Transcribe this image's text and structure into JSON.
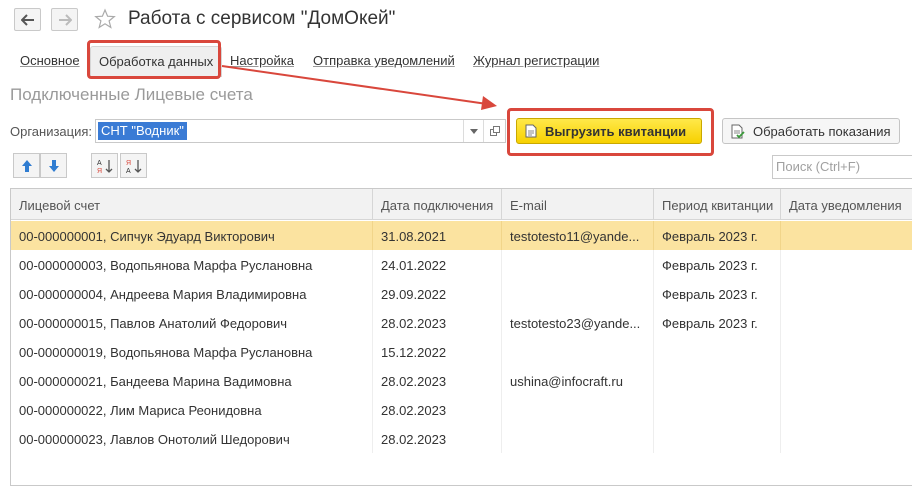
{
  "window": {
    "title": "Работа с сервисом \"ДомОкей\""
  },
  "tabs": [
    {
      "label": "Основное"
    },
    {
      "label": "Обработка данных"
    },
    {
      "label": "Настройка"
    },
    {
      "label": "Отправка уведомлений"
    },
    {
      "label": "Журнал регистрации"
    }
  ],
  "section_title": "Подключенные Лицевые счета",
  "organization": {
    "label": "Организация:",
    "value": "СНТ \"Водник\""
  },
  "buttons": {
    "export_receipts": "Выгрузить квитанции",
    "process_readings": "Обработать показания"
  },
  "search": {
    "placeholder": "Поиск (Ctrl+F)"
  },
  "table": {
    "columns": [
      "Лицевой счет",
      "Дата подключения",
      "E-mail",
      "Период квитанции",
      "Дата уведомления"
    ],
    "rows": [
      {
        "account": "00-000000001, Сипчук Эдуард Викторович",
        "date": "31.08.2021",
        "email": "testotesto11@yande...",
        "period": "Февраль 2023 г.",
        "notify": ""
      },
      {
        "account": "00-000000003, Водопьянова Марфа Руслановна",
        "date": "24.01.2022",
        "email": "",
        "period": "Февраль 2023 г.",
        "notify": ""
      },
      {
        "account": "00-000000004, Андреева Мария Владимировна",
        "date": "29.09.2022",
        "email": "",
        "period": "Февраль 2023 г.",
        "notify": ""
      },
      {
        "account": "00-000000015, Павлов Анатолий Федорович",
        "date": "28.02.2023",
        "email": "testotesto23@yande...",
        "period": "Февраль 2023 г.",
        "notify": ""
      },
      {
        "account": "00-000000019, Водопьянова Марфа Руслановна",
        "date": "15.12.2022",
        "email": "",
        "period": "",
        "notify": ""
      },
      {
        "account": "00-000000021, Бандеева Марина Вадимовна",
        "date": "28.02.2023",
        "email": "ushina@infocraft.ru",
        "period": "",
        "notify": ""
      },
      {
        "account": "00-000000022, Лим Мариса Реонидовна",
        "date": "28.02.2023",
        "email": "",
        "period": "",
        "notify": ""
      },
      {
        "account": "00-000000023, Лавлов Онотолий Шедорович",
        "date": "28.02.2023",
        "email": "",
        "period": "",
        "notify": ""
      }
    ],
    "selected_row": 0
  },
  "icons": {
    "back": "arrow-left-icon",
    "forward": "arrow-right-icon",
    "favorite": "star-icon",
    "move_up": "arrow-up-icon",
    "move_down": "arrow-down-icon",
    "sort_asc": "sort-ascending-icon",
    "sort_desc": "sort-descending-icon",
    "export": "document-icon",
    "process": "document-check-icon"
  },
  "colors": {
    "highlight_frame": "#d9473c",
    "export_button": "#f7d100",
    "selected_row": "#fbe3a0",
    "org_selection": "#3a7bd5",
    "nav_arrow_blue": "#2f7cd1"
  }
}
